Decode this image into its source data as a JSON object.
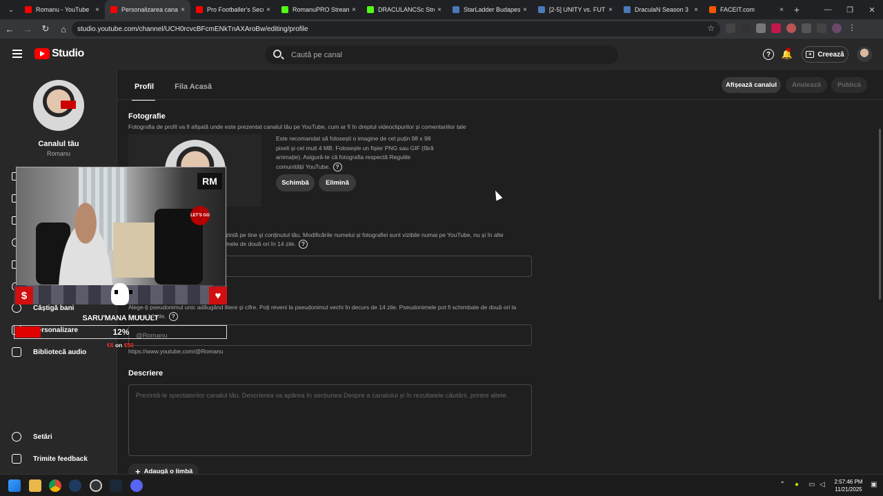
{
  "browser": {
    "tabs": [
      {
        "label": "Romanu - YouTube",
        "color": "#ff0000",
        "active": false
      },
      {
        "label": "Personalizarea canalului",
        "color": "#ff0000",
        "active": true
      },
      {
        "label": "Pro Footballer's Secr",
        "color": "#ff0000",
        "active": false
      },
      {
        "label": "RomanuPRO Stream",
        "color": "#53fc18",
        "active": false
      },
      {
        "label": "DRACULANCSc Stream",
        "color": "#53fc18",
        "active": false
      },
      {
        "label": "StarLadder Budapest",
        "color": "#4a7ab8",
        "active": false
      },
      {
        "label": "[2-5] UNITY vs. FUT",
        "color": "#4a7ab8",
        "active": false
      },
      {
        "label": "DraculaN Season 3",
        "color": "#4a7ab8",
        "active": false
      },
      {
        "label": "FACEIT.com",
        "color": "#ff5500",
        "active": false
      }
    ],
    "url": "studio.youtube.com/channel/UCH0rcvcBFcmENkTnAXAroBw/editing/profile"
  },
  "header": {
    "logo_text": "Studio",
    "search_placeholder": "Caută pe canal",
    "help_glyph": "?",
    "bell_glyph": "🔔",
    "create_label": "Creează"
  },
  "sidebar": {
    "channel_title": "Canalul tău",
    "channel_name": "Romanu",
    "items": [
      {
        "label": "Câștigă bani",
        "icon": "dollar-icon"
      },
      {
        "label": "Personalizare",
        "icon": "brush-icon"
      },
      {
        "label": "Bibliotecă audio",
        "icon": "audio-library-icon"
      },
      {
        "label": "Setări",
        "icon": "gear-icon"
      },
      {
        "label": "Trimite feedback",
        "icon": "feedback-icon"
      }
    ]
  },
  "main": {
    "tabs": [
      {
        "label": "Profil",
        "active": true
      },
      {
        "label": "Fila Acasă",
        "active": false
      }
    ],
    "actions": {
      "view_channel": "Afișează canalul",
      "cancel": "Anulează",
      "publish": "Publică"
    },
    "photo": {
      "title": "Fotografie",
      "desc": "Fotografia de profil va fi afișată unde este prezentat canalul tău pe YouTube, cum ar fi în dreptul videoclipurilor și comentariilor tale",
      "hint": "Este recomandat să folosești o imagine de cel puțin 98 x 98 pixeli și cel mult 4 MB. Folosește un fișier PNG sau GIF (fără animație). Asigură-te că fotografia respectă Regulile comunității YouTube.",
      "change": "Schimbă",
      "remove": "Elimină"
    },
    "name": {
      "desc_line1": "zintă pe tine și conținutul tău. Modificările numelui și fotografiei sunt vizibile numai pe YouTube, nu și în alte",
      "desc_line2": "mele de două ori în 14 zile."
    },
    "handle": {
      "desc": "Alege-ți pseudonimul unic adăugând litere și cifre. Poți reveni la pseudonimul vechi în decurs de 14 zile. Pseudonimele pot fi schimbate de două ori la fiecare 14 zile.",
      "value": "@Romanu",
      "url": "https://www.youtube.com/@Romanu"
    },
    "description": {
      "title": "Descriere",
      "placeholder": "Prezintă-le spectatorilor canalul tău. Descrierea va apărea în secțiunea Despre a canalului și în rezultatele căutării, printre altele."
    },
    "add_language": "Adaugă o limbă"
  },
  "overlay": {
    "name": "SARU'MANA MUUULT",
    "progress_percent": 12,
    "progress_label": "12%",
    "goal_current": "€6",
    "goal_sep": " on ",
    "goal_target": "€50",
    "logo_text": "RM",
    "badge_text": "LET'S GO",
    "accent": "#d01010"
  },
  "taskbar": {
    "time": "2:57:46 PM",
    "date": "11/21/2025"
  }
}
